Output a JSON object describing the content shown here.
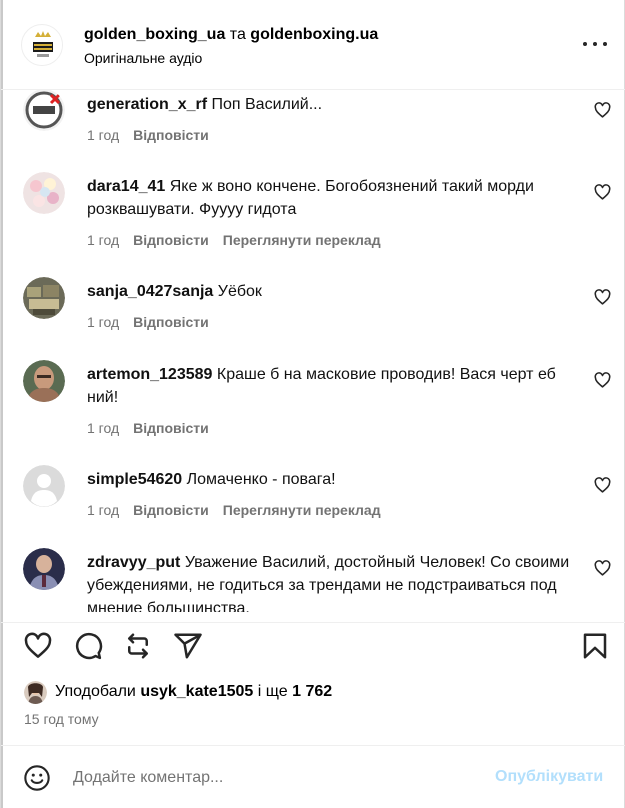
{
  "header": {
    "account1": "golden_boxing_ua",
    "conjunction": "та",
    "account2": "goldenboxing.ua",
    "audio": "Оригінальне аудіо",
    "avatar_icon": "golden-boxing-logo-icon",
    "more_icon": "more-options-icon"
  },
  "comments": [
    {
      "user": "generation_x_rf",
      "text": "Поп Василий...",
      "time": "1 год",
      "reply": "Відповісти",
      "translate": ""
    },
    {
      "user": "dara14_41",
      "text": "Яке ж воно кончене. Богобоязнений такий морди розквашувати. Фуууу гидота",
      "time": "1 год",
      "reply": "Відповісти",
      "translate": "Переглянути переклад"
    },
    {
      "user": "sanja_0427sanja",
      "text": "Уёбок",
      "time": "1 год",
      "reply": "Відповісти",
      "translate": ""
    },
    {
      "user": "artemon_123589",
      "text": "Краше б на масковие проводив! Вася черт еб  ний!",
      "time": "1 год",
      "reply": "Відповісти",
      "translate": ""
    },
    {
      "user": "simple54620",
      "text": "Ломаченко - повага!",
      "time": "1 год",
      "reply": "Відповісти",
      "translate": "Переглянути переклад"
    },
    {
      "user": "zdravyy_put",
      "text": "Уважение Василий, достойный Человек! Со своими убеждениями, не годиться за трендами не подстраиваться под мнение большинства.",
      "time": "",
      "reply": "",
      "translate": ""
    }
  ],
  "actions": {
    "like_icon": "heart-icon",
    "comment_icon": "comment-icon",
    "repost_icon": "repost-icon",
    "share_icon": "send-icon",
    "save_icon": "bookmark-icon"
  },
  "likes": {
    "prefix": "Уподобали",
    "user": "usyk_kate1505",
    "middle": "і ще",
    "count": "1 762"
  },
  "time_ago": "15 год тому",
  "composer": {
    "placeholder": "Додайте коментар...",
    "publish": "Опублікувати",
    "emoji_icon": "emoji-icon"
  },
  "colors": {
    "muted": "#737373",
    "publish_disabled": "#b2dffc",
    "border": "#efefef"
  }
}
